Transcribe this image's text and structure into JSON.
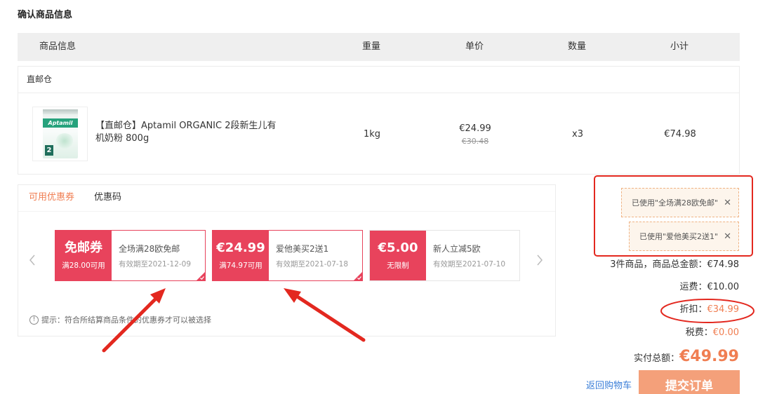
{
  "page": {
    "title": "确认商品信息"
  },
  "table_header": {
    "columns": [
      "商品信息",
      "重量",
      "单价",
      "数量",
      "小计"
    ]
  },
  "warehouse": {
    "name": "直邮仓"
  },
  "product": {
    "name": "【直邮仓】Aptamil ORGANIC 2段新生儿有机奶粉 800g",
    "image_logo_text": "Aptamil",
    "image_number": "2",
    "weight": "1kg",
    "price": "€24.99",
    "original_price": "€30.48",
    "quantity": "x3",
    "subtotal": "€74.98"
  },
  "coupon_tabs": [
    {
      "label": "可用优惠券",
      "active": true
    },
    {
      "label": "优惠码",
      "active": false
    }
  ],
  "coupons": [
    {
      "value": "免邮券",
      "condition": "满28.00可用",
      "title": "全场满28欧免邮",
      "validity": "有效期至2021-12-09",
      "selected": true
    },
    {
      "value": "€24.99",
      "condition": "满74.97可用",
      "title": "爱他美买2送1",
      "validity": "有效期至2021-07-18",
      "selected": true
    },
    {
      "value": "€5.00",
      "condition": "无限制",
      "title": "新人立减5欧",
      "validity": "有效期至2021-07-10",
      "selected": false
    }
  ],
  "hint": {
    "icon": "info-icon",
    "glyph": "!",
    "text": "提示：符合所结算商品条件的优惠券才可以被选择"
  },
  "applied_coupons": [
    {
      "label": "已使用\"全场满28欧免邮\"",
      "close_glyph": "✕"
    },
    {
      "label": "已使用\"爱他美买2送1\"",
      "close_glyph": "✕"
    }
  ],
  "summary": {
    "items_total_label": "3件商品，商品总金额：",
    "items_total": "€74.98",
    "shipping_label": "运费：",
    "shipping": "€10.00",
    "discount_label": "折扣：",
    "discount": "€34.99",
    "tax_label": "税费：",
    "tax": "€0.00",
    "total_label": "实付总额：",
    "total": "€49.99"
  },
  "actions": {
    "back_label": "返回购物车",
    "submit_label": "提交订单"
  },
  "icons": {
    "prev": "chevron-left-icon",
    "next": "chevron-right-icon",
    "selected": "check-icon",
    "remove": "close-icon"
  },
  "colors": {
    "accent_orange": "#f07e52",
    "coupon_red": "#e8435c",
    "link_blue": "#3a7ed8",
    "button_orange": "#f4a07a",
    "annotation_red": "#e3281f"
  }
}
